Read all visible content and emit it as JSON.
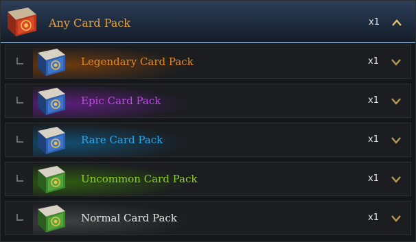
{
  "header": {
    "title": "Any Card Pack",
    "qty": "x1",
    "chevron": "chevron-up-icon",
    "icon": "red-card-pack-icon"
  },
  "rows": [
    {
      "label": "Legendary Card Pack",
      "qty": "x1",
      "color": "#e08a2a",
      "glow": "#6b3a10",
      "icon": "blue-card-pack-icon",
      "chevron": "chevron-down-icon"
    },
    {
      "label": "Epic Card Pack",
      "qty": "x1",
      "color": "#c04ae6",
      "glow": "#5a1e78",
      "icon": "blue-card-pack-icon",
      "chevron": "chevron-down-icon"
    },
    {
      "label": "Rare Card Pack",
      "qty": "x1",
      "color": "#2fa6e6",
      "glow": "#134c6e",
      "icon": "blue-card-pack-icon",
      "chevron": "chevron-down-icon"
    },
    {
      "label": "Uncommon Card Pack",
      "qty": "x1",
      "color": "#8fd12a",
      "glow": "#2f5a12",
      "icon": "green-card-pack-icon",
      "chevron": "chevron-down-icon"
    },
    {
      "label": "Normal Card Pack",
      "qty": "x1",
      "color": "#e6e6e6",
      "glow": "#3d3f42",
      "icon": "green-card-pack-icon",
      "chevron": "chevron-down-icon"
    }
  ]
}
